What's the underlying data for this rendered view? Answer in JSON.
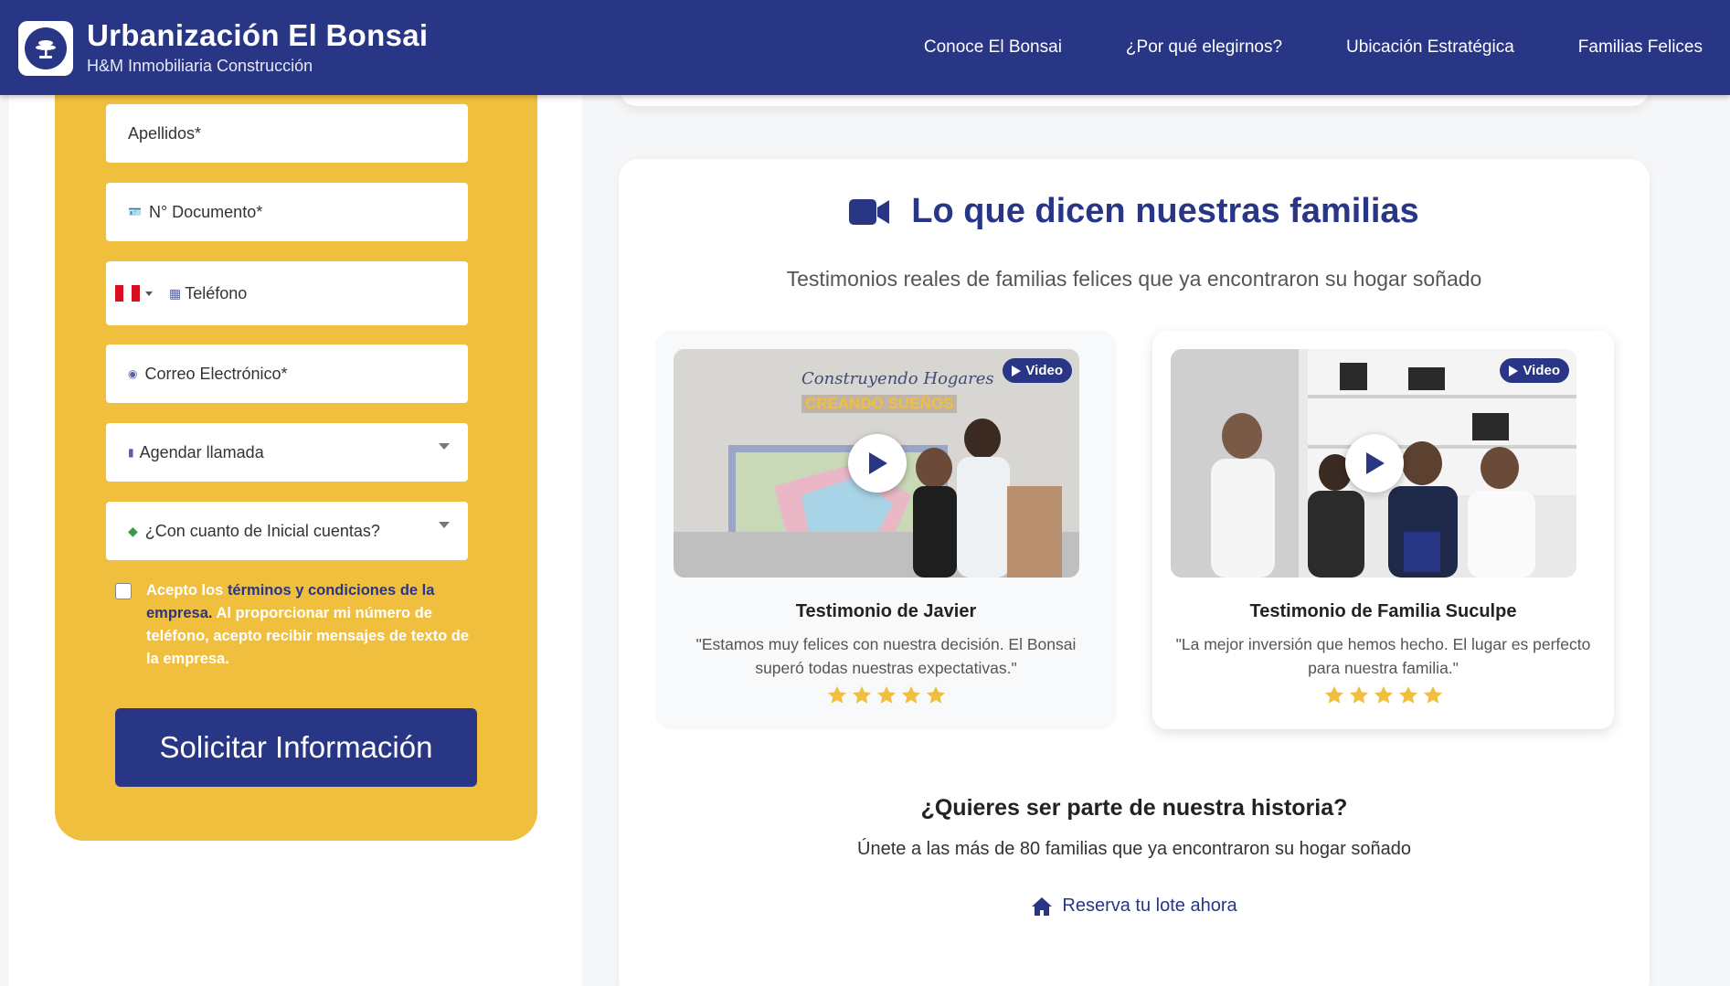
{
  "header": {
    "title": "Urbanización El Bonsai",
    "subtitle": "H&M Inmobiliaria Construcción",
    "nav": [
      "Conoce El Bonsai",
      "¿Por qué elegirnos?",
      "Ubicación Estratégica",
      "Familias Felices"
    ]
  },
  "form": {
    "apellidos": "Apellidos*",
    "documento": "N° Documento*",
    "telefono": "Teléfono",
    "correo": "Correo Electrónico*",
    "agendar": "Agendar llamada",
    "inicial": "¿Con cuanto de Inicial cuentas?",
    "consent_prefix": "Acepto los ",
    "consent_link": "términos y condiciones de la empresa.",
    "consent_rest": " Al proporcionar mi número de teléfono, acepto recibir mensajes de texto de la empresa.",
    "submit": "Solicitar Información"
  },
  "testimonials": {
    "title": "Lo que dicen nuestras familias",
    "subtitle": "Testimonios reales de familias felices que ya encontraron su hogar soñado",
    "badge": "Video",
    "video1_sign_1": "Construyendo Hogares",
    "video1_sign_2": "CREANDO SUEÑOS",
    "items": [
      {
        "name": "Testimonio de Javier",
        "quote": "\"Estamos muy felices con nuestra decisión. El Bonsai superó todas nuestras expectativas.\"",
        "rating": 5
      },
      {
        "name": "Testimonio de Familia Suculpe",
        "quote": "\"La mejor inversión que hemos hecho. El lugar es perfecto para nuestra familia.\"",
        "rating": 5
      }
    ]
  },
  "cta": {
    "title": "¿Quieres ser parte de nuestra historia?",
    "subtitle": "Únete a las más de 80 familias que ya encontraron su hogar soñado",
    "link": "Reserva tu lote ahora"
  },
  "colors": {
    "brand": "#283685",
    "accent": "#f1bf3e",
    "star": "#f1bf3e"
  }
}
